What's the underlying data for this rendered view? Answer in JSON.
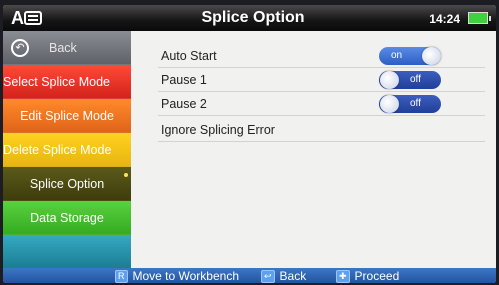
{
  "header": {
    "logo": "A",
    "title": "Splice Option",
    "time": "14:24",
    "battery_icon": "battery-full-icon"
  },
  "sidebar": {
    "back_label": "Back",
    "items": [
      {
        "label": "Select Splice Mode",
        "color": "#e62e22"
      },
      {
        "label": "Edit Splice Mode",
        "color": "#f2741f"
      },
      {
        "label": "Delete Splice Mode",
        "color": "#f4c318"
      },
      {
        "label": "Splice Option",
        "color": "#4d4c13",
        "selected": true
      },
      {
        "label": "Data Storage",
        "color": "#46c12d"
      }
    ]
  },
  "options": [
    {
      "label": "Auto Start",
      "state": "on"
    },
    {
      "label": "Pause 1",
      "state": "off"
    },
    {
      "label": "Pause 2",
      "state": "off"
    },
    {
      "label": "Ignore Splicing Error"
    }
  ],
  "footer": {
    "move_key": "R",
    "move_label": "Move to Workbench",
    "back_key": "↩",
    "back_label": "Back",
    "proceed_key": "✚",
    "proceed_label": "Proceed"
  }
}
